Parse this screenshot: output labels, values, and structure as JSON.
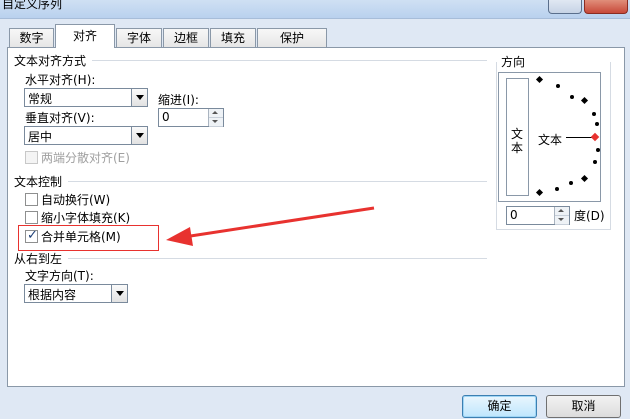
{
  "window": {
    "title": "自定义序列"
  },
  "tabs": [
    {
      "label": "数字"
    },
    {
      "label": "对齐"
    },
    {
      "label": "字体"
    },
    {
      "label": "边框"
    },
    {
      "label": "填充"
    },
    {
      "label": "保护"
    }
  ],
  "alignment": {
    "section_title": "文本对齐方式",
    "horizontal_label": "水平对齐(H):",
    "horizontal_value": "常规",
    "indent_label": "缩进(I):",
    "indent_value": "0",
    "vertical_label": "垂直对齐(V):",
    "vertical_value": "居中",
    "justify_distributed_label": "两端分散对齐(E)"
  },
  "text_control": {
    "section_title": "文本控制",
    "wrap_label": "自动换行(W)",
    "shrink_label": "缩小字体填充(K)",
    "merge_label": "合并单元格(M)",
    "merge_checked": true
  },
  "rtl": {
    "section_title": "从右到左",
    "direction_label": "文字方向(T):",
    "direction_value": "根据内容"
  },
  "orientation": {
    "section_title": "方向",
    "vertical_text": "文本",
    "horizontal_text": "文本",
    "degree_value": "0",
    "degree_label": "度(D)"
  },
  "buttons": {
    "ok": "确定",
    "cancel": "取消"
  },
  "colors": {
    "highlight_red": "#e8322f"
  }
}
